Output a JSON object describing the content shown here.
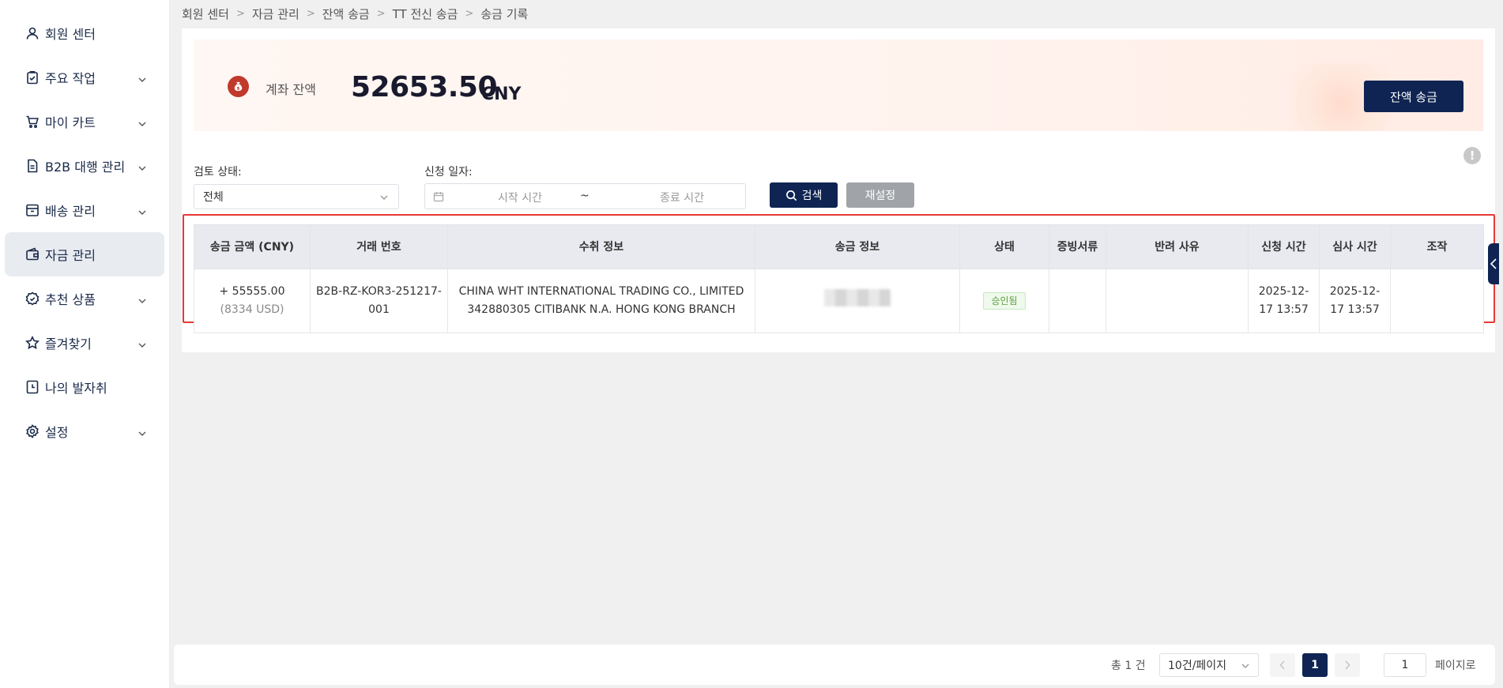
{
  "sidebar": {
    "items": [
      {
        "label": "회원 센터",
        "icon": "user-icon",
        "expandable": false
      },
      {
        "label": "주요 작업",
        "icon": "clipboard-icon",
        "expandable": true
      },
      {
        "label": "마이 카트",
        "icon": "cart-icon",
        "expandable": true
      },
      {
        "label": "B2B 대행 관리",
        "icon": "document-icon",
        "expandable": true
      },
      {
        "label": "배송 관리",
        "icon": "box-icon",
        "expandable": true
      },
      {
        "label": "자금 관리",
        "icon": "wallet-icon",
        "expandable": false,
        "active": true
      },
      {
        "label": "추천 상품",
        "icon": "badge-icon",
        "expandable": true
      },
      {
        "label": "즐겨찾기",
        "icon": "star-icon",
        "expandable": true
      },
      {
        "label": "나의 발자취",
        "icon": "history-icon",
        "expandable": false
      },
      {
        "label": "설정",
        "icon": "gear-icon",
        "expandable": true
      }
    ]
  },
  "breadcrumb": [
    "회원 센터",
    "자금 관리",
    "잔액 송금",
    "TT 전신 송금",
    "송금 기록"
  ],
  "balance": {
    "label": "계좌 잔액",
    "amount": "52653.50",
    "currency": "CNY",
    "button_label": "잔액 송금"
  },
  "filters": {
    "status_label": "검토 상태:",
    "status_value": "전체",
    "date_label": "신청 일자:",
    "start_placeholder": "시작 시간",
    "separator": "~",
    "end_placeholder": "종료 시간",
    "search_label": "검색",
    "reset_label": "재설정"
  },
  "table": {
    "headers": [
      "송금 금액 (CNY)",
      "거래 번호",
      "수취 정보",
      "송금 정보",
      "상태",
      "증빙서류",
      "반려 사유",
      "신청 시간",
      "심사 시간",
      "조작"
    ],
    "rows": [
      {
        "amount": "+ 55555.00",
        "amount_usd": "(8334 USD)",
        "txn_line1": "B2B-RZ-KOR3-251217-",
        "txn_line2": "001",
        "payee_line1": "CHINA WHT INTERNATIONAL TRADING CO., LIMITED",
        "payee_line2": "342880305 CITIBANK N.A. HONG KONG BRANCH",
        "status": "승인됨",
        "proof": "",
        "reject_reason": "",
        "applied_line1": "2025-12-",
        "applied_line2": "17 13:57",
        "reviewed_line1": "2025-12-",
        "reviewed_line2": "17 13:57",
        "action": ""
      }
    ]
  },
  "pagination": {
    "total": "총 1 건",
    "page_size": "10건/페이지",
    "current_page": "1",
    "jump_value": "1",
    "jump_label": "페이지로"
  },
  "colors": {
    "primary": "#0f2452",
    "highlight_frame": "#e53935",
    "status_approved": "#5aa03c"
  }
}
